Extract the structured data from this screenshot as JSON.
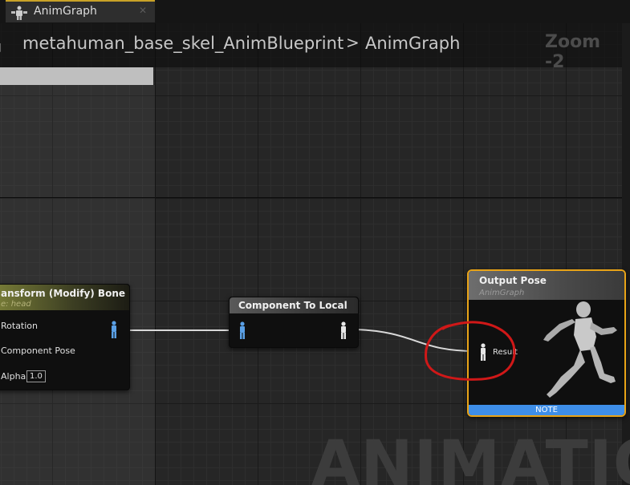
{
  "tab": {
    "label": "AnimGraph",
    "icon": "animgraph-icon"
  },
  "breadcrumb": {
    "blueprint": "metahuman_base_skel_AnimBlueprint",
    "separator": ">",
    "graph": "AnimGraph"
  },
  "zoom": "Zoom -2",
  "nodes": {
    "transform_bone": {
      "title": "ansform (Modify) Bone",
      "subtitle": "e: head",
      "pins": {
        "rotation": "Rotation",
        "component_pose": "Component Pose",
        "alpha": "Alpha",
        "alpha_value": "1.0"
      }
    },
    "component_to_local": {
      "title": "Component To Local"
    },
    "output_pose": {
      "title": "Output Pose",
      "subtitle": "AnimGraph",
      "pin": "Result",
      "note": "NOTE"
    }
  },
  "watermark": "ANIMATION",
  "colors": {
    "tab_accent": "#c9a227",
    "output_pose_border": "#e8a317",
    "pose_pin": "#5aa0e6",
    "annotation": "#d01818",
    "note_bar": "#3e8ee8"
  }
}
